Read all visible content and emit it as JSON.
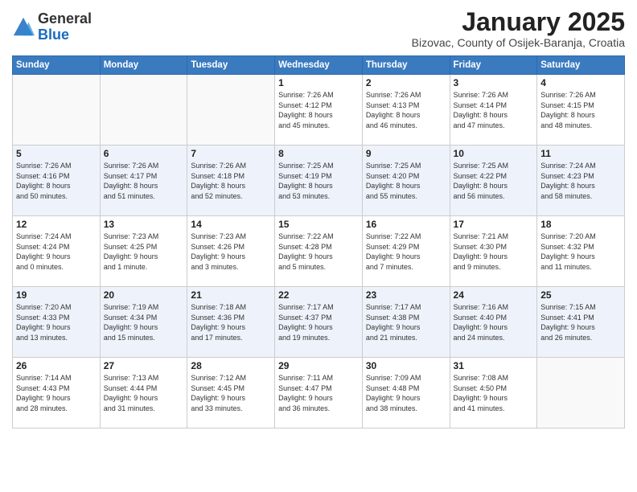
{
  "header": {
    "logo_general": "General",
    "logo_blue": "Blue",
    "month_title": "January 2025",
    "location": "Bizovac, County of Osijek-Baranja, Croatia"
  },
  "days_of_week": [
    "Sunday",
    "Monday",
    "Tuesday",
    "Wednesday",
    "Thursday",
    "Friday",
    "Saturday"
  ],
  "weeks": [
    [
      {
        "day": "",
        "info": ""
      },
      {
        "day": "",
        "info": ""
      },
      {
        "day": "",
        "info": ""
      },
      {
        "day": "1",
        "info": "Sunrise: 7:26 AM\nSunset: 4:12 PM\nDaylight: 8 hours\nand 45 minutes."
      },
      {
        "day": "2",
        "info": "Sunrise: 7:26 AM\nSunset: 4:13 PM\nDaylight: 8 hours\nand 46 minutes."
      },
      {
        "day": "3",
        "info": "Sunrise: 7:26 AM\nSunset: 4:14 PM\nDaylight: 8 hours\nand 47 minutes."
      },
      {
        "day": "4",
        "info": "Sunrise: 7:26 AM\nSunset: 4:15 PM\nDaylight: 8 hours\nand 48 minutes."
      }
    ],
    [
      {
        "day": "5",
        "info": "Sunrise: 7:26 AM\nSunset: 4:16 PM\nDaylight: 8 hours\nand 50 minutes."
      },
      {
        "day": "6",
        "info": "Sunrise: 7:26 AM\nSunset: 4:17 PM\nDaylight: 8 hours\nand 51 minutes."
      },
      {
        "day": "7",
        "info": "Sunrise: 7:26 AM\nSunset: 4:18 PM\nDaylight: 8 hours\nand 52 minutes."
      },
      {
        "day": "8",
        "info": "Sunrise: 7:25 AM\nSunset: 4:19 PM\nDaylight: 8 hours\nand 53 minutes."
      },
      {
        "day": "9",
        "info": "Sunrise: 7:25 AM\nSunset: 4:20 PM\nDaylight: 8 hours\nand 55 minutes."
      },
      {
        "day": "10",
        "info": "Sunrise: 7:25 AM\nSunset: 4:22 PM\nDaylight: 8 hours\nand 56 minutes."
      },
      {
        "day": "11",
        "info": "Sunrise: 7:24 AM\nSunset: 4:23 PM\nDaylight: 8 hours\nand 58 minutes."
      }
    ],
    [
      {
        "day": "12",
        "info": "Sunrise: 7:24 AM\nSunset: 4:24 PM\nDaylight: 9 hours\nand 0 minutes."
      },
      {
        "day": "13",
        "info": "Sunrise: 7:23 AM\nSunset: 4:25 PM\nDaylight: 9 hours\nand 1 minute."
      },
      {
        "day": "14",
        "info": "Sunrise: 7:23 AM\nSunset: 4:26 PM\nDaylight: 9 hours\nand 3 minutes."
      },
      {
        "day": "15",
        "info": "Sunrise: 7:22 AM\nSunset: 4:28 PM\nDaylight: 9 hours\nand 5 minutes."
      },
      {
        "day": "16",
        "info": "Sunrise: 7:22 AM\nSunset: 4:29 PM\nDaylight: 9 hours\nand 7 minutes."
      },
      {
        "day": "17",
        "info": "Sunrise: 7:21 AM\nSunset: 4:30 PM\nDaylight: 9 hours\nand 9 minutes."
      },
      {
        "day": "18",
        "info": "Sunrise: 7:20 AM\nSunset: 4:32 PM\nDaylight: 9 hours\nand 11 minutes."
      }
    ],
    [
      {
        "day": "19",
        "info": "Sunrise: 7:20 AM\nSunset: 4:33 PM\nDaylight: 9 hours\nand 13 minutes."
      },
      {
        "day": "20",
        "info": "Sunrise: 7:19 AM\nSunset: 4:34 PM\nDaylight: 9 hours\nand 15 minutes."
      },
      {
        "day": "21",
        "info": "Sunrise: 7:18 AM\nSunset: 4:36 PM\nDaylight: 9 hours\nand 17 minutes."
      },
      {
        "day": "22",
        "info": "Sunrise: 7:17 AM\nSunset: 4:37 PM\nDaylight: 9 hours\nand 19 minutes."
      },
      {
        "day": "23",
        "info": "Sunrise: 7:17 AM\nSunset: 4:38 PM\nDaylight: 9 hours\nand 21 minutes."
      },
      {
        "day": "24",
        "info": "Sunrise: 7:16 AM\nSunset: 4:40 PM\nDaylight: 9 hours\nand 24 minutes."
      },
      {
        "day": "25",
        "info": "Sunrise: 7:15 AM\nSunset: 4:41 PM\nDaylight: 9 hours\nand 26 minutes."
      }
    ],
    [
      {
        "day": "26",
        "info": "Sunrise: 7:14 AM\nSunset: 4:43 PM\nDaylight: 9 hours\nand 28 minutes."
      },
      {
        "day": "27",
        "info": "Sunrise: 7:13 AM\nSunset: 4:44 PM\nDaylight: 9 hours\nand 31 minutes."
      },
      {
        "day": "28",
        "info": "Sunrise: 7:12 AM\nSunset: 4:45 PM\nDaylight: 9 hours\nand 33 minutes."
      },
      {
        "day": "29",
        "info": "Sunrise: 7:11 AM\nSunset: 4:47 PM\nDaylight: 9 hours\nand 36 minutes."
      },
      {
        "day": "30",
        "info": "Sunrise: 7:09 AM\nSunset: 4:48 PM\nDaylight: 9 hours\nand 38 minutes."
      },
      {
        "day": "31",
        "info": "Sunrise: 7:08 AM\nSunset: 4:50 PM\nDaylight: 9 hours\nand 41 minutes."
      },
      {
        "day": "",
        "info": ""
      }
    ]
  ]
}
